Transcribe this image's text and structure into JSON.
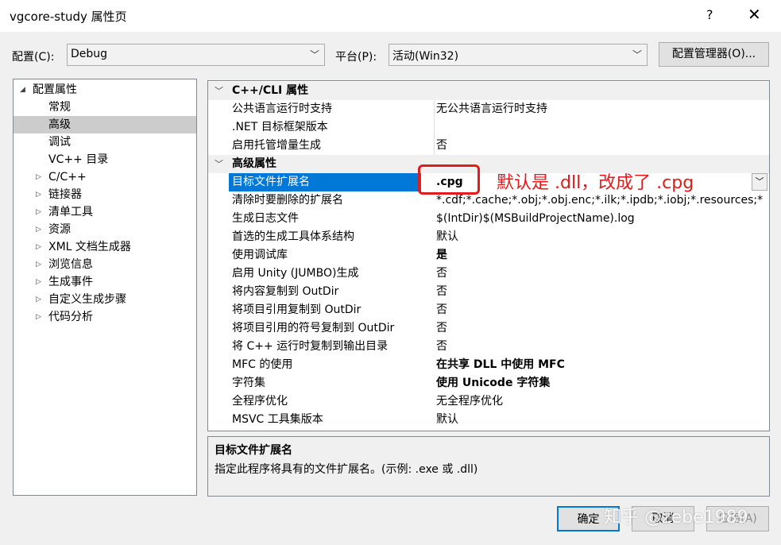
{
  "window": {
    "title": "vgcore-study 属性页",
    "help": "?",
    "close": "✕"
  },
  "config": {
    "label": "配置(C):",
    "value": "Debug"
  },
  "platform": {
    "label": "平台(P):",
    "value": "活动(Win32)"
  },
  "config_manager": "配置管理器(O)...",
  "tree": [
    {
      "label": "配置属性",
      "expanded": true
    },
    {
      "label": "常规"
    },
    {
      "label": "高级"
    },
    {
      "label": "调试"
    },
    {
      "label": "VC++ 目录"
    },
    {
      "label": "C/C++"
    },
    {
      "label": "链接器"
    },
    {
      "label": "清单工具"
    },
    {
      "label": "资源"
    },
    {
      "label": "XML 文档生成器"
    },
    {
      "label": "浏览信息"
    },
    {
      "label": "生成事件"
    },
    {
      "label": "自定义生成步骤"
    },
    {
      "label": "代码分析"
    }
  ],
  "grid": {
    "cat1": "C++/CLI 属性",
    "cat1_rows": [
      {
        "name": "公共语言运行时支持",
        "value": "无公共语言运行时支持"
      },
      {
        "name": ".NET 目标框架版本",
        "value": ""
      },
      {
        "name": "启用托管增量生成",
        "value": "否"
      }
    ],
    "cat2": "高级属性",
    "cat2_rows": [
      {
        "name": "目标文件扩展名",
        "value": ".cpg"
      },
      {
        "name": "清除时要删除的扩展名",
        "value": "*.cdf;*.cache;*.obj;*.obj.enc;*.ilk;*.ipdb;*.iobj;*.resources;*"
      },
      {
        "name": "生成日志文件",
        "value": "$(IntDir)$(MSBuildProjectName).log"
      },
      {
        "name": "首选的生成工具体系结构",
        "value": "默认"
      },
      {
        "name": "使用调试库",
        "value": "是"
      },
      {
        "name": "启用 Unity (JUMBO)生成",
        "value": "否"
      },
      {
        "name": "将内容复制到 OutDir",
        "value": "否"
      },
      {
        "name": "将项目引用复制到 OutDir",
        "value": "否"
      },
      {
        "name": "将项目引用的符号复制到 OutDir",
        "value": "否"
      },
      {
        "name": "将 C++ 运行时复制到输出目录",
        "value": "否"
      },
      {
        "name": "MFC 的使用",
        "value": "在共享 DLL 中使用 MFC"
      },
      {
        "name": "字符集",
        "value": "使用 Unicode 字符集"
      },
      {
        "name": "全程序优化",
        "value": "无全程序优化"
      },
      {
        "name": "MSVC 工具集版本",
        "value": "默认"
      }
    ]
  },
  "annotation": "默认是 .dll，改成了 .cpg",
  "description": {
    "title": "目标文件扩展名",
    "text": "指定此程序将具有的文件扩展名。(示例: .exe 或 .dll)"
  },
  "buttons": {
    "ok": "确定",
    "cancel": "取消",
    "apply": "应用(A)"
  },
  "watermark": "知乎 @zebe1989",
  "colors": {
    "selection": "#0078d7",
    "annotation": "#e21b1b"
  }
}
